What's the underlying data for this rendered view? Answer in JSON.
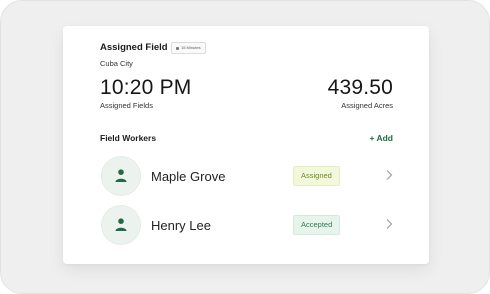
{
  "card": {
    "title": "Assigned Field",
    "chip_label": "15 Minutes",
    "subtitle": "Cuba City"
  },
  "stats": {
    "time_value": "10:20 PM",
    "time_label": "Assigned Fields",
    "acres_value": "439.50",
    "acres_label": "Assigned Acres"
  },
  "workers": {
    "section_title": "Field Workers",
    "add_label": "+ Add",
    "items": [
      {
        "name": "Maple Grove",
        "status": "Assigned"
      },
      {
        "name": "Henry Lee",
        "status": "Accepted"
      }
    ]
  },
  "colors": {
    "brand_green": "#1f6b45",
    "assigned_text": "#6b8a1f",
    "accepted_text": "#2f7a50"
  },
  "icons": {
    "avatar": "person-icon",
    "chevron": "chevron-right-icon",
    "chip": "clock-icon"
  }
}
